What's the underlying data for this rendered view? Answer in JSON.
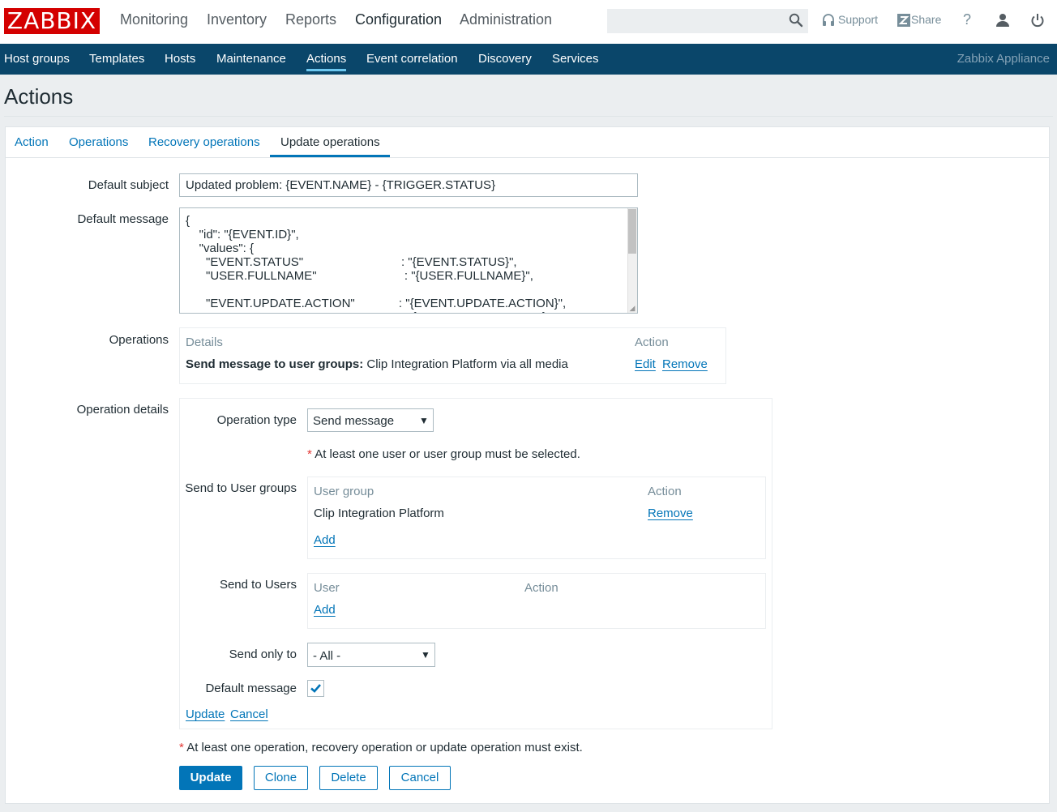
{
  "brand": {
    "logo_text": "ZABBIX",
    "logo_color": "#d40000",
    "appliance_label": "Zabbix Appliance"
  },
  "main_nav": [
    "Monitoring",
    "Inventory",
    "Reports",
    "Configuration",
    "Administration"
  ],
  "main_nav_active": "Configuration",
  "top_links": {
    "support": "Support",
    "share": "Share",
    "help_glyph": "?"
  },
  "top_icons": [
    "search-icon",
    "headset-icon",
    "share-z-icon",
    "help-icon",
    "user-icon",
    "power-icon"
  ],
  "sub_nav": [
    "Host groups",
    "Templates",
    "Hosts",
    "Maintenance",
    "Actions",
    "Event correlation",
    "Discovery",
    "Services"
  ],
  "sub_nav_active": "Actions",
  "page": {
    "title": "Actions"
  },
  "tabs": [
    "Action",
    "Operations",
    "Recovery operations",
    "Update operations"
  ],
  "tabs_active": "Update operations",
  "form": {
    "default_subject_label": "Default subject",
    "default_subject_value": "Updated problem: {EVENT.NAME} - {TRIGGER.STATUS}",
    "default_message_label": "Default message",
    "default_message_value": "{\n    \"id\": \"{EVENT.ID}\",\n    \"values\": {\n      \"EVENT.STATUS\"                             : \"{EVENT.STATUS}\",\n      \"USER.FULLNAME\"                          : \"{USER.FULLNAME}\",\n\n      \"EVENT.UPDATE.ACTION\"             : \"{EVENT.UPDATE.ACTION}\",\n      \"EVENT.UPDATE.DATE\"                  : \"{EVENT.UPDATE.DATE}\",",
    "operations_label": "Operations",
    "operations_headers": {
      "details": "Details",
      "action": "Action"
    },
    "operations_row": {
      "detail_bold": "Send message to user groups:",
      "detail_rest": " Clip Integration Platform via all media",
      "edit": "Edit",
      "remove": "Remove"
    },
    "operation_details_label": "Operation details",
    "operation_type_label": "Operation type",
    "operation_type_value": "Send message",
    "required_note": "At least one user or user group must be selected.",
    "required_star": "*",
    "send_to_user_groups_label": "Send to User groups",
    "user_groups_headers": {
      "user_group": "User group",
      "action": "Action"
    },
    "user_groups": [
      {
        "name": "Clip Integration Platform",
        "action": "Remove"
      }
    ],
    "user_groups_add": "Add",
    "send_to_users_label": "Send to Users",
    "users_headers": {
      "user": "User",
      "action": "Action"
    },
    "users_add": "Add",
    "send_only_to_label": "Send only to",
    "send_only_to_value": "- All -",
    "default_message_check_label": "Default message",
    "default_message_checked": true,
    "detail_update": "Update",
    "detail_cancel": "Cancel",
    "global_note": "At least one operation, recovery operation or update operation must exist."
  },
  "buttons": {
    "update": "Update",
    "clone": "Clone",
    "delete": "Delete",
    "cancel": "Cancel"
  },
  "colors": {
    "accent": "#0275b8",
    "subnav_bg": "#0a466a",
    "required": "#e33734"
  }
}
